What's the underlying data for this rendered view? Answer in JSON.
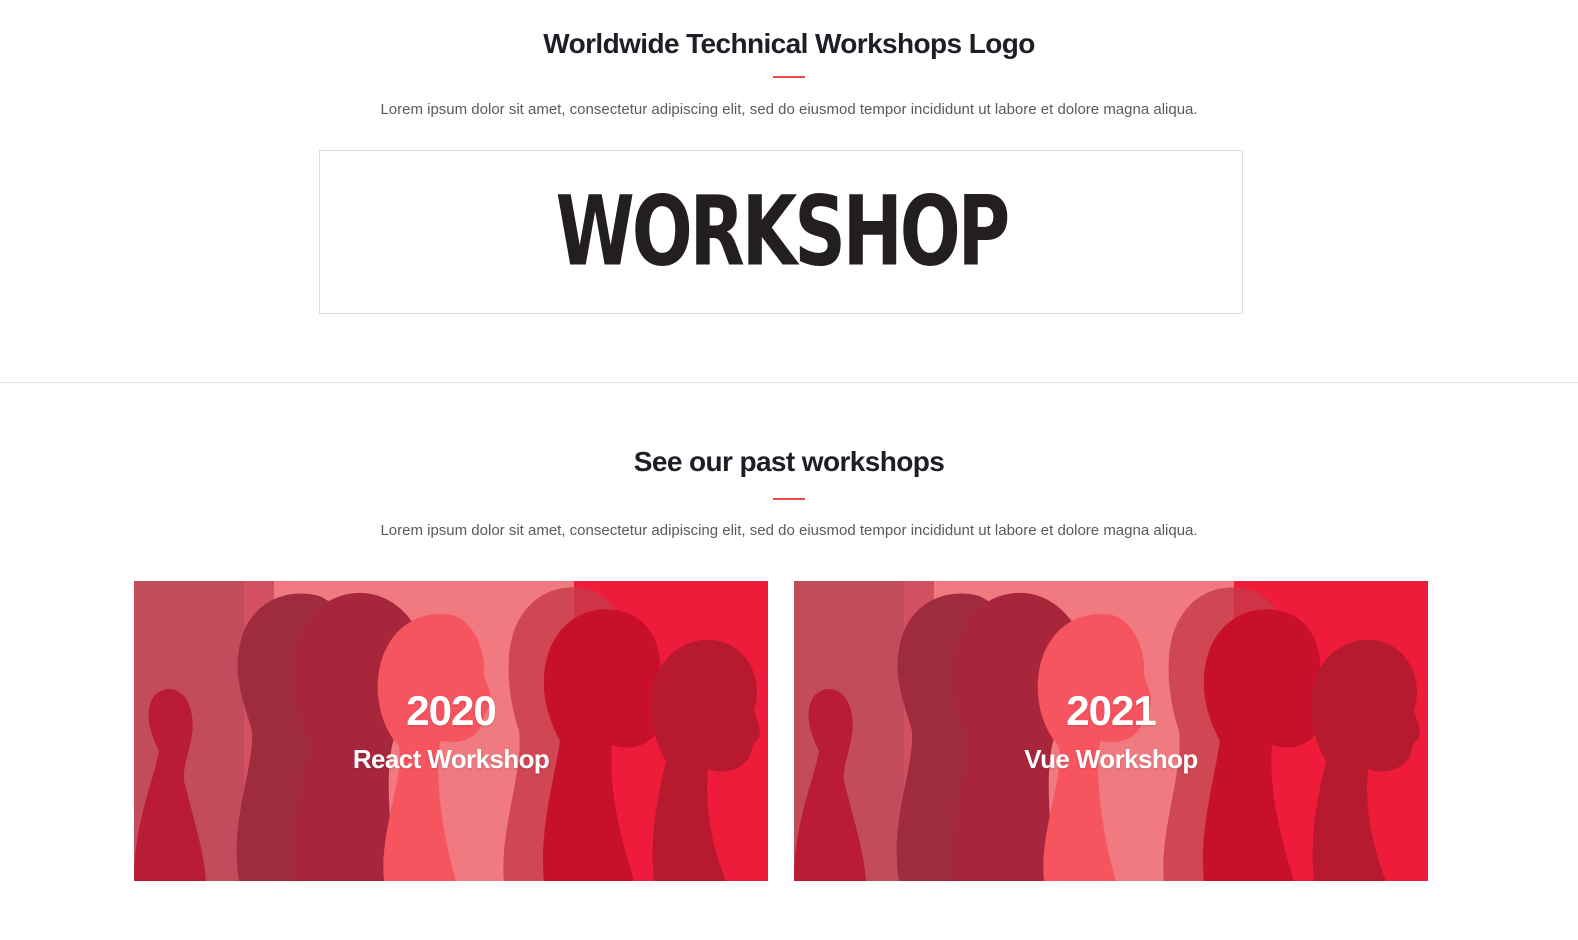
{
  "logo_section": {
    "title": "Worldwide Technical Workshops Logo",
    "description": "Lorem ipsum dolor sit amet, consectetur adipiscing elit, sed do eiusmod tempor incididunt ut labore et dolore magna aliqua.",
    "logo_text": "WORKSHOP"
  },
  "past_section": {
    "title": "See our past workshops",
    "description": "Lorem ipsum dolor sit amet, consectetur adipiscing elit, sed do eiusmod tempor incididunt ut labore et dolore magna aliqua.",
    "workshops": [
      {
        "year": "2020",
        "name": "React Workshop"
      },
      {
        "year": "2021",
        "name": "Vue Workshop"
      }
    ]
  },
  "colors": {
    "accent": "#e94b4b",
    "heading": "#1d1f27",
    "body_text": "#5a5a5a",
    "card_red": "#e5384a"
  }
}
